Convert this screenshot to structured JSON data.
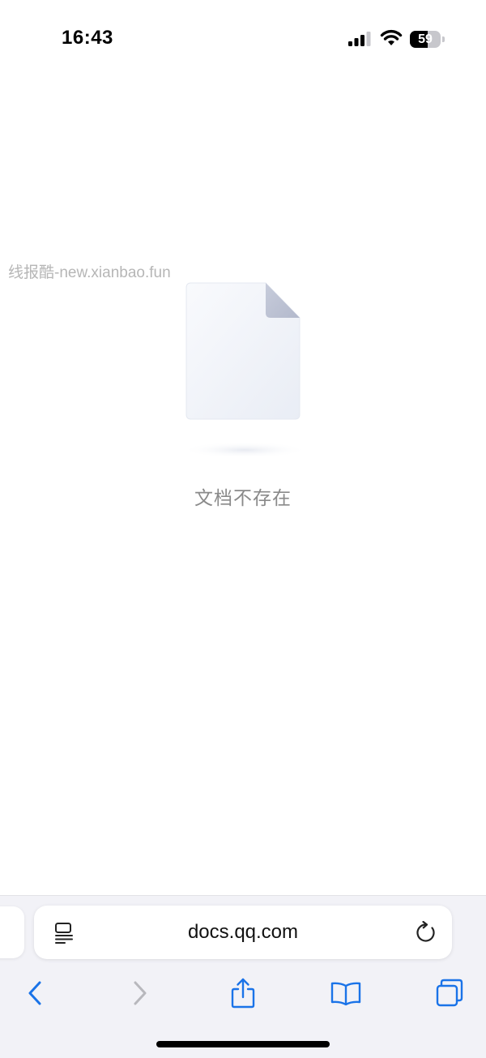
{
  "status_bar": {
    "time": "16:43",
    "battery_level": "59",
    "battery_fraction": 0.59
  },
  "watermark": {
    "text": "线报酷-new.xianbao.fun"
  },
  "main": {
    "empty_message": "文档不存在",
    "illustration_icon": "empty-document-icon"
  },
  "browser": {
    "address": "docs.qq.com",
    "icons": {
      "reader": "reader-mode-icon",
      "reload": "reload-icon",
      "back": "back-chevron-icon",
      "forward": "forward-chevron-icon",
      "share": "share-icon",
      "bookmarks": "bookmarks-icon",
      "tabs": "tabs-icon"
    },
    "accent_color": "#1a73e8",
    "disabled_color": "#b8b8bd"
  }
}
